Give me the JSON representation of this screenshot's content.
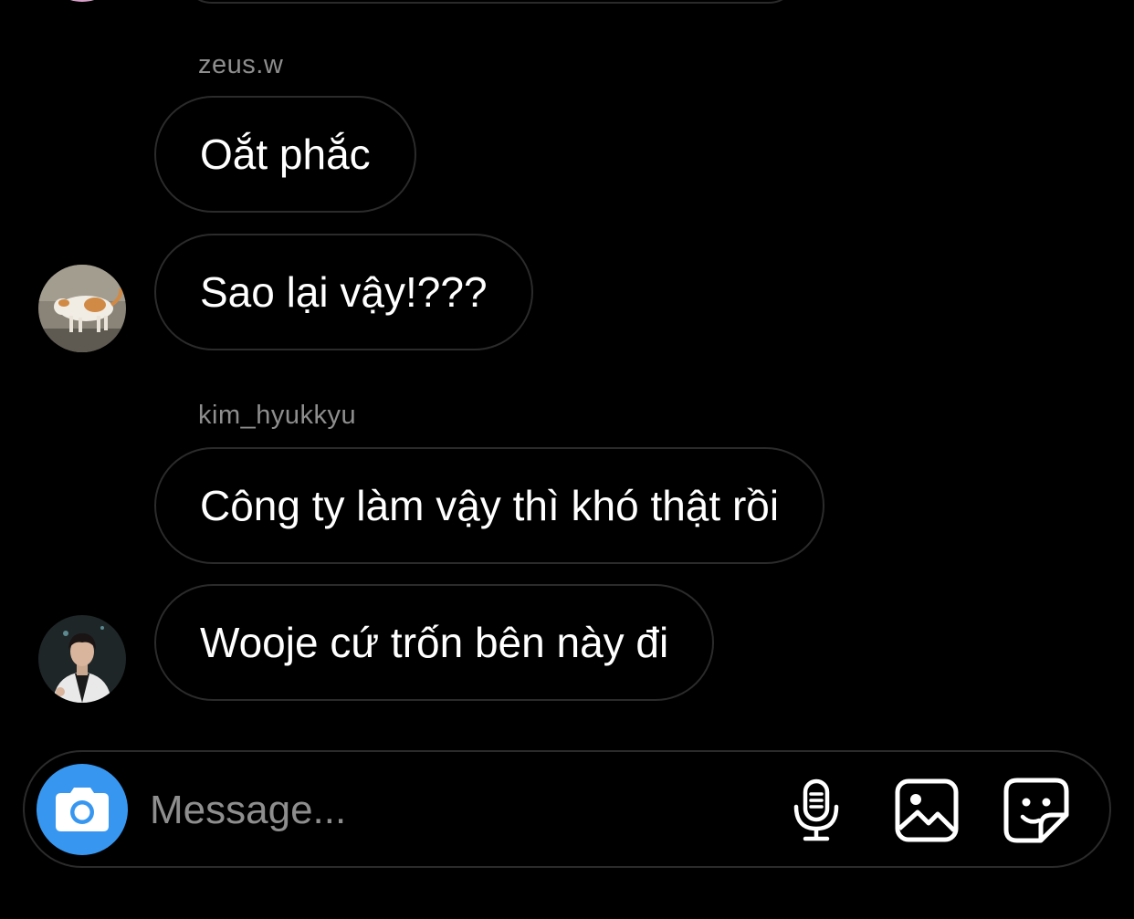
{
  "messages": [
    {
      "sender": "zeus.w",
      "texts": [
        "Oắt phắc",
        "Sao lại vậy!???"
      ],
      "avatar": "cat-photo"
    },
    {
      "sender": "kim_hyukkyu",
      "texts": [
        "Công ty làm vậy thì khó thật rồi",
        "Wooje cứ trốn bên này đi"
      ],
      "avatar": "person-photo"
    }
  ],
  "composer": {
    "placeholder": "Message...",
    "camera_icon": "camera-icon",
    "mic_icon": "microphone-icon",
    "gallery_icon": "image-icon",
    "sticker_icon": "sticker-icon"
  },
  "colors": {
    "background": "#000000",
    "bubble_border": "#2b2b2b",
    "sender_text": "#8e8e8e",
    "accent": "#3797f0"
  }
}
